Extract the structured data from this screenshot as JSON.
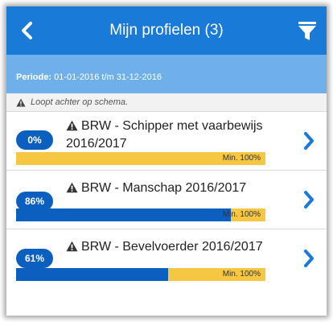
{
  "header": {
    "title": "Mijn profielen (3)"
  },
  "periode": {
    "label": "Periode:",
    "value": " 01-01-2016 t/m 31-12-2016"
  },
  "notice": {
    "text": "Loopt achter op schema."
  },
  "profiles": [
    {
      "percent_label": "0%",
      "progress": 0.0,
      "title": "BRW - Schipper met vaarbewijs 2016/2017",
      "min_label": "Min. 100%"
    },
    {
      "percent_label": "86%",
      "progress": 0.86,
      "title": "BRW - Manschap 2016/2017",
      "min_label": "Min. 100%"
    },
    {
      "percent_label": "61%",
      "progress": 0.61,
      "title": "BRW - Bevelvoerder 2016/2017",
      "min_label": "Min. 100%"
    }
  ],
  "colors": {
    "header_bg": "#1a7ad8",
    "periode_bg": "#6fb0ea",
    "badge_bg": "#0b5fbf",
    "bar_fill": "#0b5fbf",
    "bar_track": "#f6c743"
  },
  "icons": {
    "back": "chevron-left-icon",
    "filter": "filter-icon",
    "warning": "warning-triangle-icon",
    "item_chevron": "chevron-right-icon"
  }
}
